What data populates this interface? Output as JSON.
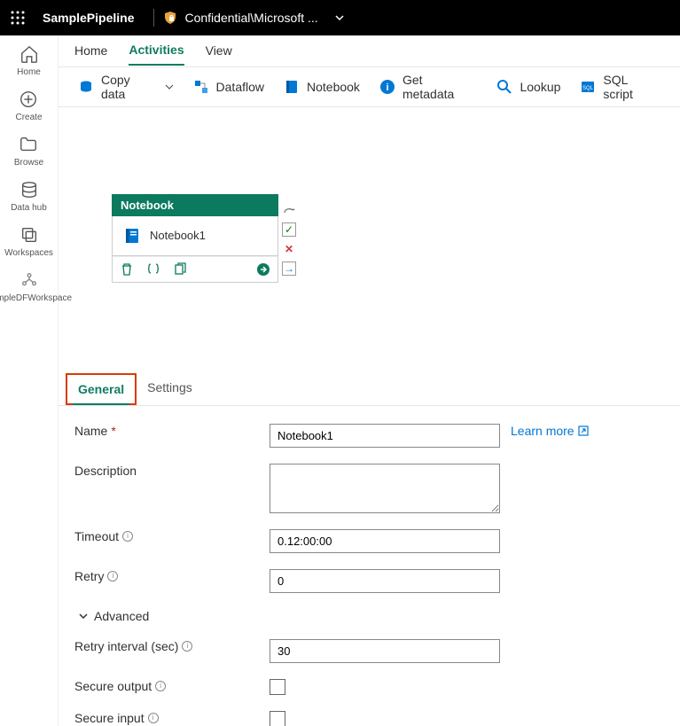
{
  "topbar": {
    "title": "SamplePipeline",
    "breadcrumb": "Confidential\\Microsoft ..."
  },
  "leftrail": [
    {
      "label": "Home"
    },
    {
      "label": "Create"
    },
    {
      "label": "Browse"
    },
    {
      "label": "Data hub"
    },
    {
      "label": "Workspaces"
    },
    {
      "label": "SampleDFWorkspace"
    }
  ],
  "pageTabs": {
    "home": "Home",
    "activities": "Activities",
    "view": "View"
  },
  "toolbar": {
    "copydata": "Copy data",
    "dataflow": "Dataflow",
    "notebook": "Notebook",
    "getmetadata": "Get metadata",
    "lookup": "Lookup",
    "sqlscript": "SQL script"
  },
  "node": {
    "header": "Notebook",
    "name": "Notebook1"
  },
  "propTabs": {
    "general": "General",
    "settings": "Settings"
  },
  "form": {
    "nameLabel": "Name",
    "nameValue": "Notebook1",
    "learnMore": "Learn more",
    "descLabel": "Description",
    "descValue": "",
    "timeoutLabel": "Timeout",
    "timeoutValue": "0.12:00:00",
    "retryLabel": "Retry",
    "retryValue": "0",
    "advanced": "Advanced",
    "retryIntervalLabel": "Retry interval (sec)",
    "retryIntervalValue": "30",
    "secureOutputLabel": "Secure output",
    "secureInputLabel": "Secure input"
  }
}
